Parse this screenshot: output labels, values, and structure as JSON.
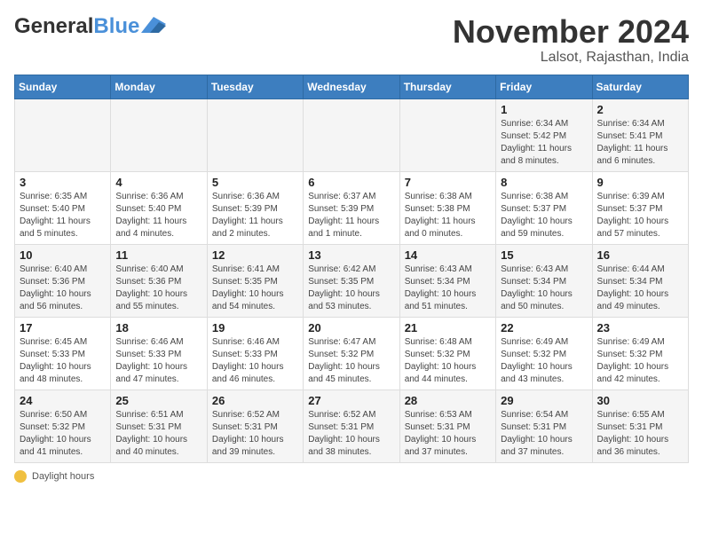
{
  "header": {
    "logo_general": "General",
    "logo_blue": "Blue",
    "month_title": "November 2024",
    "location": "Lalsot, Rajasthan, India"
  },
  "days_of_week": [
    "Sunday",
    "Monday",
    "Tuesday",
    "Wednesday",
    "Thursday",
    "Friday",
    "Saturday"
  ],
  "weeks": [
    [
      {
        "day": "",
        "info": ""
      },
      {
        "day": "",
        "info": ""
      },
      {
        "day": "",
        "info": ""
      },
      {
        "day": "",
        "info": ""
      },
      {
        "day": "",
        "info": ""
      },
      {
        "day": "1",
        "info": "Sunrise: 6:34 AM\nSunset: 5:42 PM\nDaylight: 11 hours and 8 minutes."
      },
      {
        "day": "2",
        "info": "Sunrise: 6:34 AM\nSunset: 5:41 PM\nDaylight: 11 hours and 6 minutes."
      }
    ],
    [
      {
        "day": "3",
        "info": "Sunrise: 6:35 AM\nSunset: 5:40 PM\nDaylight: 11 hours and 5 minutes."
      },
      {
        "day": "4",
        "info": "Sunrise: 6:36 AM\nSunset: 5:40 PM\nDaylight: 11 hours and 4 minutes."
      },
      {
        "day": "5",
        "info": "Sunrise: 6:36 AM\nSunset: 5:39 PM\nDaylight: 11 hours and 2 minutes."
      },
      {
        "day": "6",
        "info": "Sunrise: 6:37 AM\nSunset: 5:39 PM\nDaylight: 11 hours and 1 minute."
      },
      {
        "day": "7",
        "info": "Sunrise: 6:38 AM\nSunset: 5:38 PM\nDaylight: 11 hours and 0 minutes."
      },
      {
        "day": "8",
        "info": "Sunrise: 6:38 AM\nSunset: 5:37 PM\nDaylight: 10 hours and 59 minutes."
      },
      {
        "day": "9",
        "info": "Sunrise: 6:39 AM\nSunset: 5:37 PM\nDaylight: 10 hours and 57 minutes."
      }
    ],
    [
      {
        "day": "10",
        "info": "Sunrise: 6:40 AM\nSunset: 5:36 PM\nDaylight: 10 hours and 56 minutes."
      },
      {
        "day": "11",
        "info": "Sunrise: 6:40 AM\nSunset: 5:36 PM\nDaylight: 10 hours and 55 minutes."
      },
      {
        "day": "12",
        "info": "Sunrise: 6:41 AM\nSunset: 5:35 PM\nDaylight: 10 hours and 54 minutes."
      },
      {
        "day": "13",
        "info": "Sunrise: 6:42 AM\nSunset: 5:35 PM\nDaylight: 10 hours and 53 minutes."
      },
      {
        "day": "14",
        "info": "Sunrise: 6:43 AM\nSunset: 5:34 PM\nDaylight: 10 hours and 51 minutes."
      },
      {
        "day": "15",
        "info": "Sunrise: 6:43 AM\nSunset: 5:34 PM\nDaylight: 10 hours and 50 minutes."
      },
      {
        "day": "16",
        "info": "Sunrise: 6:44 AM\nSunset: 5:34 PM\nDaylight: 10 hours and 49 minutes."
      }
    ],
    [
      {
        "day": "17",
        "info": "Sunrise: 6:45 AM\nSunset: 5:33 PM\nDaylight: 10 hours and 48 minutes."
      },
      {
        "day": "18",
        "info": "Sunrise: 6:46 AM\nSunset: 5:33 PM\nDaylight: 10 hours and 47 minutes."
      },
      {
        "day": "19",
        "info": "Sunrise: 6:46 AM\nSunset: 5:33 PM\nDaylight: 10 hours and 46 minutes."
      },
      {
        "day": "20",
        "info": "Sunrise: 6:47 AM\nSunset: 5:32 PM\nDaylight: 10 hours and 45 minutes."
      },
      {
        "day": "21",
        "info": "Sunrise: 6:48 AM\nSunset: 5:32 PM\nDaylight: 10 hours and 44 minutes."
      },
      {
        "day": "22",
        "info": "Sunrise: 6:49 AM\nSunset: 5:32 PM\nDaylight: 10 hours and 43 minutes."
      },
      {
        "day": "23",
        "info": "Sunrise: 6:49 AM\nSunset: 5:32 PM\nDaylight: 10 hours and 42 minutes."
      }
    ],
    [
      {
        "day": "24",
        "info": "Sunrise: 6:50 AM\nSunset: 5:32 PM\nDaylight: 10 hours and 41 minutes."
      },
      {
        "day": "25",
        "info": "Sunrise: 6:51 AM\nSunset: 5:31 PM\nDaylight: 10 hours and 40 minutes."
      },
      {
        "day": "26",
        "info": "Sunrise: 6:52 AM\nSunset: 5:31 PM\nDaylight: 10 hours and 39 minutes."
      },
      {
        "day": "27",
        "info": "Sunrise: 6:52 AM\nSunset: 5:31 PM\nDaylight: 10 hours and 38 minutes."
      },
      {
        "day": "28",
        "info": "Sunrise: 6:53 AM\nSunset: 5:31 PM\nDaylight: 10 hours and 37 minutes."
      },
      {
        "day": "29",
        "info": "Sunrise: 6:54 AM\nSunset: 5:31 PM\nDaylight: 10 hours and 37 minutes."
      },
      {
        "day": "30",
        "info": "Sunrise: 6:55 AM\nSunset: 5:31 PM\nDaylight: 10 hours and 36 minutes."
      }
    ]
  ],
  "legend": {
    "daylight_label": "Daylight hours"
  }
}
